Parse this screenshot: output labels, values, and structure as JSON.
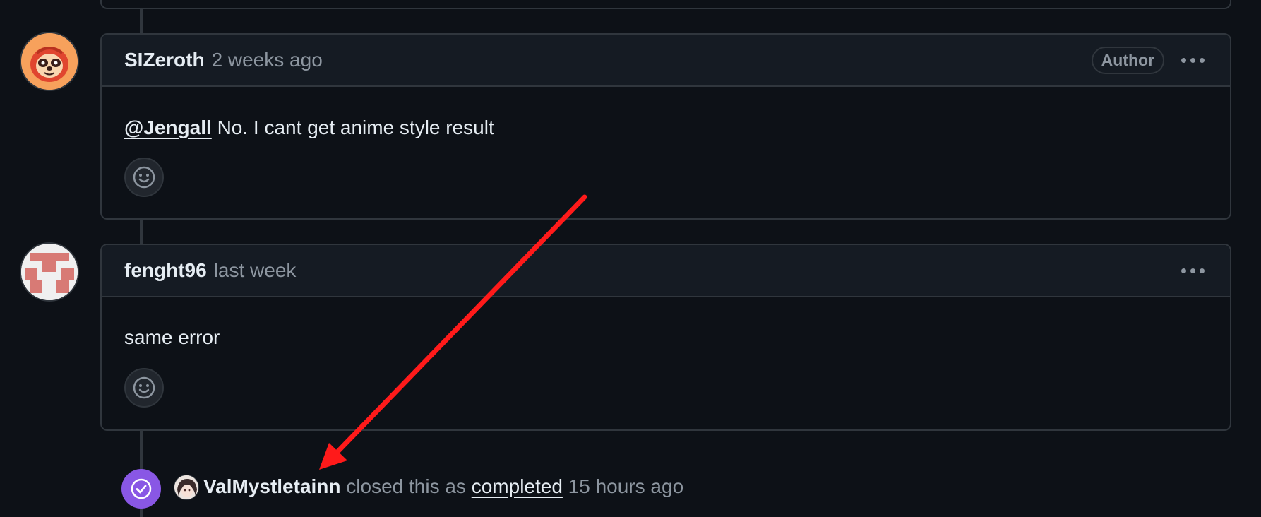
{
  "comments": [
    {
      "author": "SIZeroth",
      "time": "2 weeks ago",
      "badge": "Author",
      "mention": "@Jengall",
      "text": " No. I cant get anime style result",
      "avatar": "sloth-avatar"
    },
    {
      "author": "fenght96",
      "time": "last week",
      "text": "same error",
      "avatar": "identicon-avatar"
    }
  ],
  "event": {
    "user": "ValMystletainn",
    "action": " closed this as ",
    "state": "completed",
    "time": " 15 hours ago",
    "icon": "check-circle-icon"
  },
  "colors": {
    "background": "#0d1117",
    "border": "#30363d",
    "closed_purple": "#8957e5",
    "annotation_arrow": "#ff1a1a"
  }
}
